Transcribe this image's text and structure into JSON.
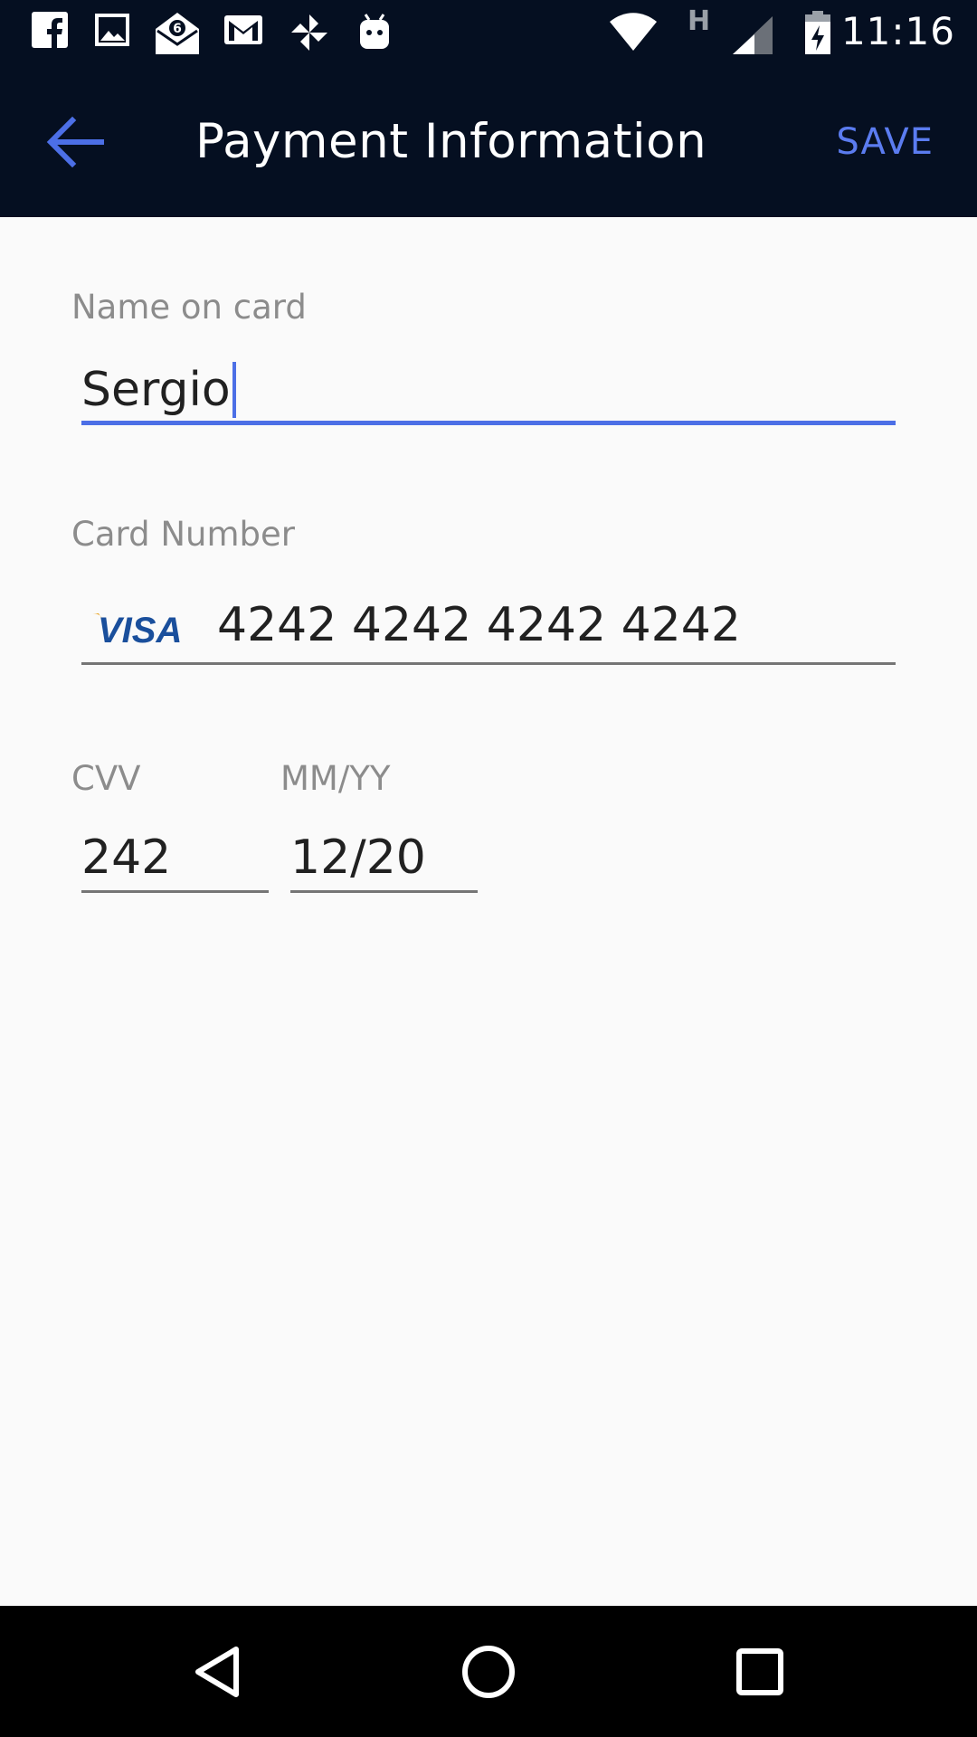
{
  "status_bar": {
    "time": "11:16",
    "network_type": "H",
    "left_icons": [
      "facebook-icon",
      "image-icon",
      "mail-open-icon",
      "gmail-icon",
      "pinwheel-icon",
      "android-icon"
    ],
    "right_icons": [
      "wifi-icon",
      "signal-icon",
      "battery-charging-icon"
    ]
  },
  "app_bar": {
    "title": "Payment Information",
    "save_label": "SAVE",
    "back_icon": "arrow-back-icon"
  },
  "form": {
    "name": {
      "label": "Name on card",
      "value": "Sergio",
      "focused": true
    },
    "card_number": {
      "label": "Card Number",
      "value": "4242 4242 4242 4242",
      "brand": "VISA"
    },
    "cvv": {
      "label": "CVV",
      "value": "242"
    },
    "expiry": {
      "label": "MM/YY",
      "value": "12/20"
    }
  },
  "nav_bar": {
    "buttons": [
      "back-triangle-icon",
      "home-circle-icon",
      "recents-square-icon"
    ]
  },
  "colors": {
    "app_bar_bg": "#050f21",
    "accent": "#4c6fe6",
    "save": "#5b7cf0",
    "visa_blue": "#1a4f9c",
    "visa_gold": "#e9a21e"
  }
}
